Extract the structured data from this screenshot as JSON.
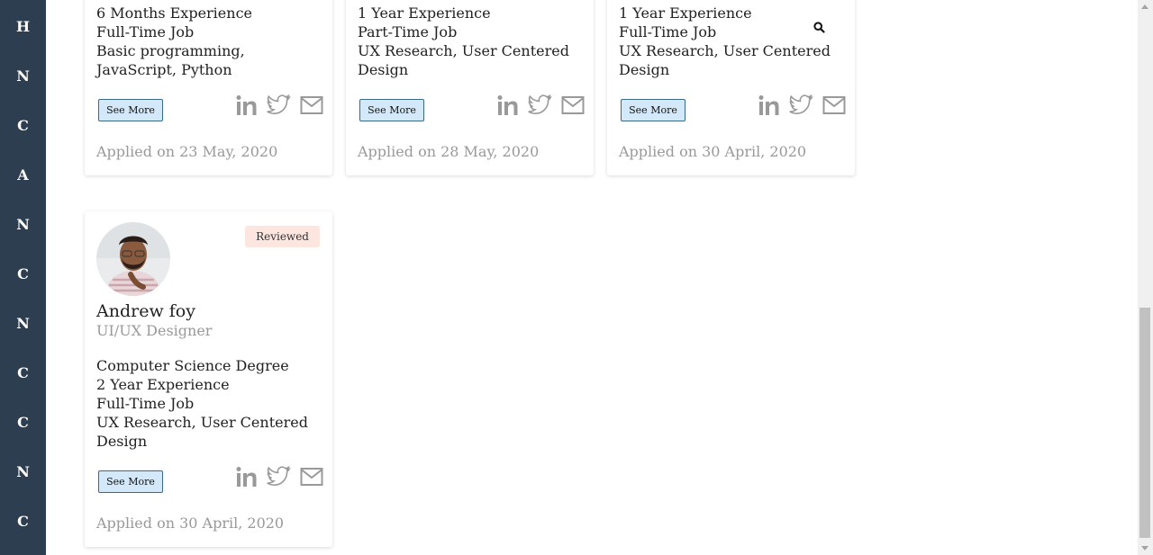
{
  "sidebar": {
    "letters": [
      "H",
      "N",
      "C",
      "A",
      "N",
      "C",
      "N",
      "C",
      "C",
      "N",
      "C"
    ]
  },
  "cards": [
    {
      "lines": [
        "6 Months Experience",
        "Full-Time Job",
        "Basic programming, JavaScript, Python"
      ],
      "see_more": "See More",
      "applied": "Applied on 23 May, 2020"
    },
    {
      "lines": [
        "1 Year Experience",
        "Part-Time Job",
        "UX Research, User Centered Design"
      ],
      "see_more": "See More",
      "applied": "Applied on 28 May, 2020"
    },
    {
      "lines": [
        "1 Year Experience",
        "Full-Time Job",
        "UX Research, User Centered Design"
      ],
      "see_more": "See More",
      "applied": "Applied on 30 April, 2020"
    },
    {
      "badge": "Reviewed",
      "name": "Andrew foy",
      "role": "UI/UX Designer",
      "lines": [
        "Computer Science Degree",
        "2 Year Experience",
        "Full-Time Job",
        "UX Research, User Centered Design"
      ],
      "see_more": "See More",
      "applied": "Applied on 30 April, 2020"
    }
  ],
  "icons": {
    "social": [
      "linkedin-icon",
      "twitter-icon",
      "mail-icon"
    ],
    "search": "search-icon"
  }
}
